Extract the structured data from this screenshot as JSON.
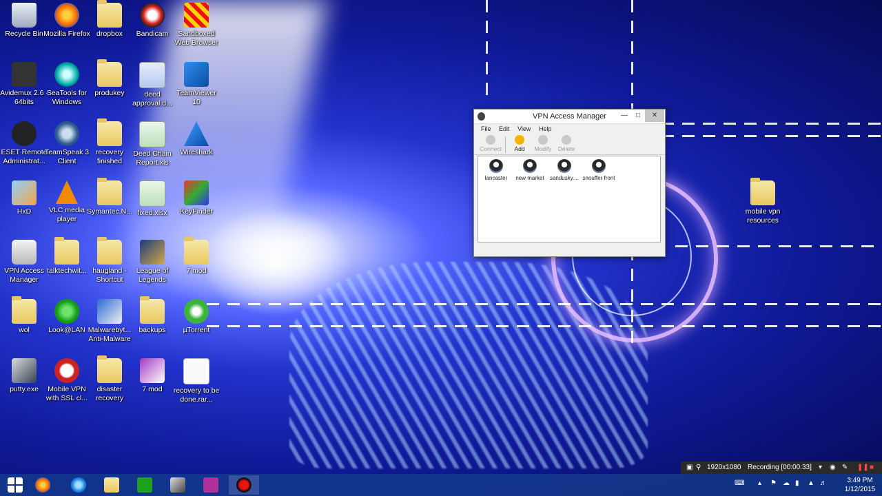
{
  "desktop": {
    "icons": [
      {
        "label": "Recycle Bin",
        "icon": "recycle-bin-icon"
      },
      {
        "label": "Mozilla Firefox",
        "icon": "firefox-icon"
      },
      {
        "label": "dropbox",
        "icon": "folder-icon"
      },
      {
        "label": "Bandicam",
        "icon": "bandicam-icon"
      },
      {
        "label": "Sandboxed Web Browser",
        "icon": "sandboxed-browser-icon"
      },
      {
        "label": "Avidemux 2.6 - 64bits",
        "icon": "avidemux-icon"
      },
      {
        "label": "SeaTools for Windows",
        "icon": "seatools-icon"
      },
      {
        "label": "produkey",
        "icon": "folder-icon"
      },
      {
        "label": "deed approval.d...",
        "icon": "word-document-icon"
      },
      {
        "label": "TeamViewer 10",
        "icon": "teamviewer-icon"
      },
      {
        "label": "ESET Remote Administrat...",
        "icon": "eset-icon"
      },
      {
        "label": "TeamSpeak 3 Client",
        "icon": "teamspeak-icon"
      },
      {
        "label": "recovery finished",
        "icon": "folder-icon"
      },
      {
        "label": "Deed Chain Report.xls",
        "icon": "excel-document-icon"
      },
      {
        "label": "Wireshark",
        "icon": "wireshark-icon"
      },
      {
        "label": "HxD",
        "icon": "hxd-icon"
      },
      {
        "label": "VLC media player",
        "icon": "vlc-icon"
      },
      {
        "label": "Symantec.N...",
        "icon": "folder-icon"
      },
      {
        "label": "fixed.xlsx",
        "icon": "excel-document-icon"
      },
      {
        "label": "KeyFinder",
        "icon": "keyfinder-icon"
      },
      {
        "label": "VPN Access Manager",
        "icon": "vpn-lock-icon"
      },
      {
        "label": "talktechwit...",
        "icon": "folder-icon"
      },
      {
        "label": "haugland - Shortcut",
        "icon": "folder-icon"
      },
      {
        "label": "League of Legends",
        "icon": "league-of-legends-icon"
      },
      {
        "label": "7 mod",
        "icon": "folder-icon"
      },
      {
        "label": "wol",
        "icon": "folder-icon"
      },
      {
        "label": "Look@LAN",
        "icon": "lookatlan-icon"
      },
      {
        "label": "Malwarebyt... Anti-Malware",
        "icon": "malwarebytes-icon"
      },
      {
        "label": "backups",
        "icon": "folder-icon"
      },
      {
        "label": "µTorrent",
        "icon": "utorrent-icon"
      },
      {
        "label": "putty.exe",
        "icon": "putty-icon"
      },
      {
        "label": "Mobile VPN with SSL cl...",
        "icon": "mobile-vpn-icon"
      },
      {
        "label": "disaster recovery",
        "icon": "folder-icon"
      },
      {
        "label": "7 mod",
        "icon": "onenote-icon"
      },
      {
        "label": "recovery to be done.rar...",
        "icon": "torrent-file-icon"
      },
      {
        "label": "mobile vpn resources",
        "icon": "folder-icon"
      }
    ]
  },
  "vpn_window": {
    "title": "VPN Access Manager",
    "menu": [
      "File",
      "Edit",
      "View",
      "Help"
    ],
    "toolbar": {
      "connect": "Connect",
      "add": "Add",
      "modify": "Modify",
      "delete": "Delete"
    },
    "connections": [
      "lancaster",
      "new market",
      "sandusky....",
      "snouffer front"
    ]
  },
  "recording_bar": {
    "resolution": "1920x1080",
    "status": "Recording [00:00:33]"
  },
  "taskbar": {
    "apps": [
      "start-icon",
      "firefox-icon",
      "internet-explorer-icon",
      "file-explorer-icon",
      "store-icon",
      "taskmanager-icon",
      "camera-icon",
      "bandicam-record-icon"
    ]
  },
  "clock": {
    "time": "3:49 PM",
    "date": "1/12/2015"
  }
}
